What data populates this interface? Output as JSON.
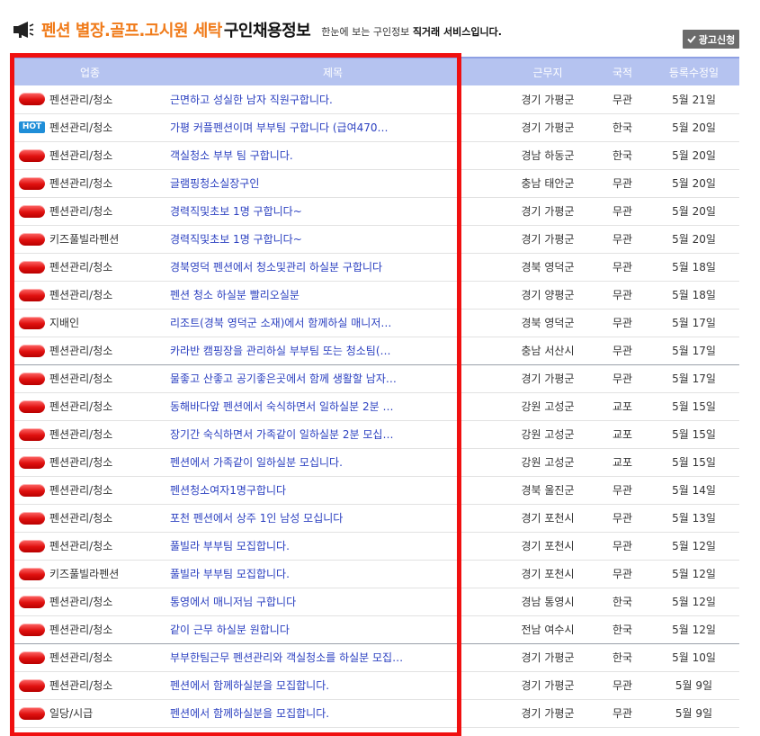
{
  "header": {
    "title_orange": "펜션 별장.골프.고시원 세탁",
    "title_black": "구인채용정보",
    "subtitle_prefix": "한눈에 보는 구인정보",
    "subtitle_bold": "직거래 서비스입니다.",
    "ad_button": "광고신청"
  },
  "table": {
    "headers": [
      "업종",
      "제목",
      "근무지",
      "국적",
      "등록수정일"
    ],
    "rows": [
      {
        "badge": "red",
        "category": "펜션관리/청소",
        "title": "근면하고 성실한 남자 직원구합니다.",
        "location": "경기 가평군",
        "nationality": "무관",
        "date": "5월 21일"
      },
      {
        "badge": "hot",
        "badge_text": "HOT",
        "category": "펜션관리/청소",
        "title": "가평 커플펜션이며 부부팀 구합니다 (급여470…",
        "location": "경기 가평군",
        "nationality": "한국",
        "date": "5월 20일"
      },
      {
        "badge": "red",
        "category": "펜션관리/청소",
        "title": "객실청소 부부 팀 구합니다.",
        "location": "경남 하동군",
        "nationality": "한국",
        "date": "5월 20일"
      },
      {
        "badge": "red",
        "category": "펜션관리/청소",
        "title": "글램핑청소실장구인",
        "location": "충남 태안군",
        "nationality": "무관",
        "date": "5월 20일"
      },
      {
        "badge": "red",
        "category": "펜션관리/청소",
        "title": "경력직및초보 1명 구합니다~",
        "location": "경기 가평군",
        "nationality": "무관",
        "date": "5월 20일"
      },
      {
        "badge": "red",
        "category": "키즈풀빌라펜션",
        "title": "경력직및초보 1명 구합니다~",
        "location": "경기 가평군",
        "nationality": "무관",
        "date": "5월 20일"
      },
      {
        "badge": "red",
        "category": "펜션관리/청소",
        "title": "경북영덕 펜션에서 청소및관리 하실분 구합니다",
        "location": "경북 영덕군",
        "nationality": "무관",
        "date": "5월 18일"
      },
      {
        "badge": "red",
        "category": "펜션관리/청소",
        "title": "펜션 청소 하실분 빨리오실분",
        "location": "경기 양평군",
        "nationality": "무관",
        "date": "5월 18일"
      },
      {
        "badge": "red",
        "category": "지배인",
        "title": "리조트(경북 영덕군 소재)에서 함께하실 매니저…",
        "location": "경북 영덕군",
        "nationality": "무관",
        "date": "5월 17일"
      },
      {
        "badge": "red",
        "category": "펜션관리/청소",
        "title": "카라반 캠핑장을 관리하실 부부팀 또는 청소팀(…",
        "location": "충남 서산시",
        "nationality": "무관",
        "date": "5월 17일"
      },
      {
        "badge": "red",
        "category": "펜션관리/청소",
        "title": "물좋고 산좋고 공기좋은곳에서 함께 생활할 남자…",
        "location": "경기 가평군",
        "nationality": "무관",
        "date": "5월 17일"
      },
      {
        "badge": "red",
        "category": "펜션관리/청소",
        "title": "동해바다앞 펜션에서 숙식하면서 일하실분 2분 …",
        "location": "강원 고성군",
        "nationality": "교포",
        "date": "5월 15일"
      },
      {
        "badge": "red",
        "category": "펜션관리/청소",
        "title": "장기간 숙식하면서 가족같이 일하실분 2분 모십…",
        "location": "강원 고성군",
        "nationality": "교포",
        "date": "5월 15일"
      },
      {
        "badge": "red",
        "category": "펜션관리/청소",
        "title": "펜션에서 가족같이 일하실분 모십니다.",
        "location": "강원 고성군",
        "nationality": "교포",
        "date": "5월 15일"
      },
      {
        "badge": "red",
        "category": "펜션관리/청소",
        "title": "펜션청소여자1명구합니다",
        "location": "경북 울진군",
        "nationality": "무관",
        "date": "5월 14일"
      },
      {
        "badge": "red",
        "category": "펜션관리/청소",
        "title": "포천 펜션에서 상주 1인 남성 모십니다",
        "location": "경기 포천시",
        "nationality": "무관",
        "date": "5월 13일"
      },
      {
        "badge": "red",
        "category": "펜션관리/청소",
        "title": "풀빌라 부부팀 모집합니다.",
        "location": "경기 포천시",
        "nationality": "무관",
        "date": "5월 12일"
      },
      {
        "badge": "red",
        "category": "키즈풀빌라펜션",
        "title": "풀빌라 부부팀 모집합니다.",
        "location": "경기 포천시",
        "nationality": "무관",
        "date": "5월 12일"
      },
      {
        "badge": "red",
        "category": "펜션관리/청소",
        "title": "통영에서 매니저님 구합니다",
        "location": "경남 통영시",
        "nationality": "한국",
        "date": "5월 12일"
      },
      {
        "badge": "red",
        "category": "펜션관리/청소",
        "title": "같이 근무 하실분 원합니다",
        "location": "전남 여수시",
        "nationality": "한국",
        "date": "5월 12일"
      },
      {
        "badge": "red",
        "category": "펜션관리/청소",
        "title": "부부한팀근무 펜션관리와 객실청소를 하실분 모집…",
        "location": "경기 가평군",
        "nationality": "한국",
        "date": "5월 10일"
      },
      {
        "badge": "red",
        "category": "펜션관리/청소",
        "title": "펜션에서 함께하실분을 모집합니다.",
        "location": "경기 가평군",
        "nationality": "무관",
        "date": "5월 9일"
      },
      {
        "badge": "red",
        "category": "일당/시급",
        "title": "펜션에서 함께하실분을 모집합니다.",
        "location": "경기 가평군",
        "nationality": "무관",
        "date": "5월 9일"
      }
    ]
  },
  "colors": {
    "title_orange": "#f07b1a",
    "header_bg": "#b5c3f0",
    "link_blue": "#2a3fc0",
    "highlight_red": "#f01010"
  }
}
